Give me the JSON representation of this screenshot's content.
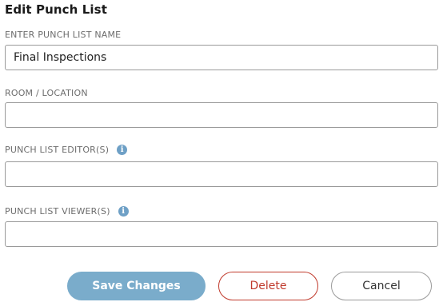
{
  "dialog": {
    "title": "Edit Punch List"
  },
  "fields": {
    "name": {
      "label": "ENTER PUNCH LIST NAME",
      "value": "Final Inspections",
      "placeholder": ""
    },
    "location": {
      "label": "ROOM / LOCATION",
      "value": "",
      "placeholder": ""
    },
    "editors": {
      "label": "PUNCH LIST EDITOR(S)",
      "info_icon": "info-icon",
      "value": "",
      "placeholder": ""
    },
    "viewers": {
      "label": "PUNCH LIST VIEWER(S)",
      "info_icon": "info-icon",
      "value": "",
      "placeholder": ""
    }
  },
  "actions": {
    "save_label": "Save Changes",
    "delete_label": "Delete",
    "cancel_label": "Cancel"
  },
  "colors": {
    "accent": "#7aaccb",
    "danger": "#c0392b",
    "info": "#6ea0c6"
  }
}
